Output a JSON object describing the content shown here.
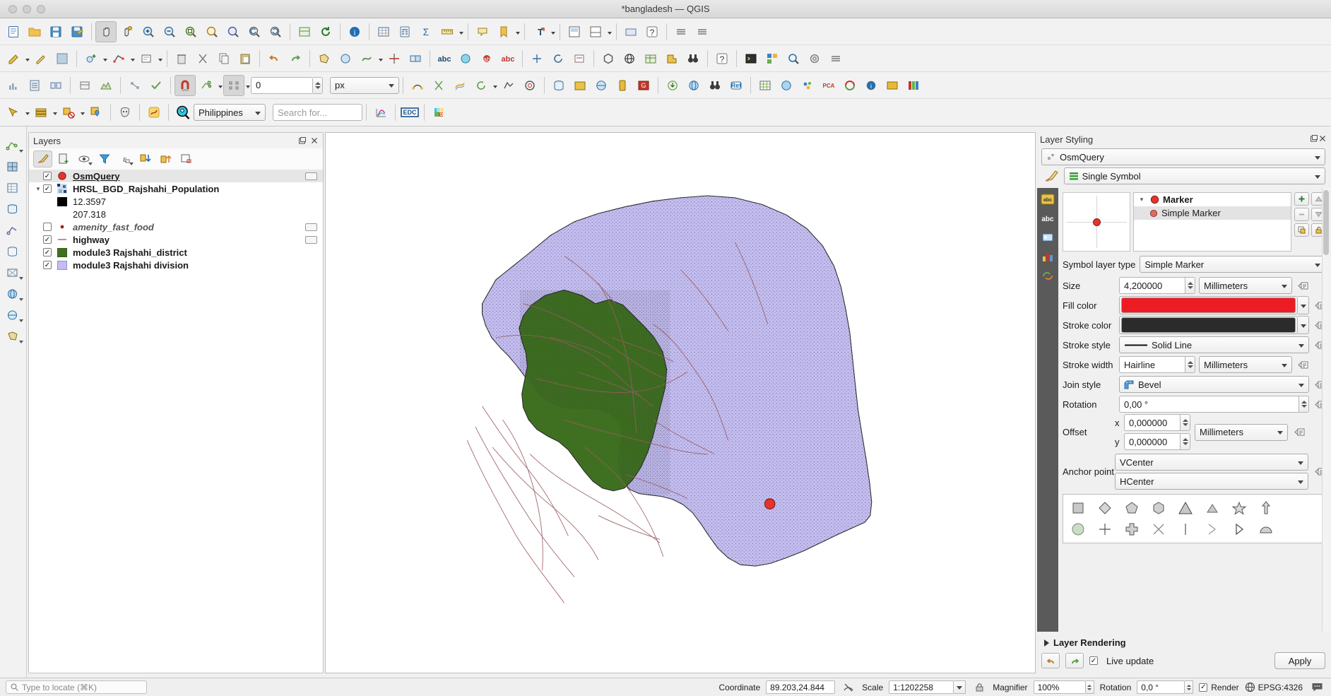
{
  "window": {
    "title": "*bangladesh — QGIS"
  },
  "toolbar": {
    "snapping_units_value": "0",
    "snapping_units": "px",
    "country_selector": "Philippines",
    "search_placeholder": "Search for...",
    "edc_label": "EDC"
  },
  "layers_panel": {
    "title": "Layers",
    "items": [
      {
        "name": "OsmQuery",
        "checked": true,
        "style": "bold-underline",
        "symbol": "red-circle",
        "indent": 0,
        "expander": "",
        "badge": true,
        "selected": true
      },
      {
        "name": "HRSL_BGD_Rajshahi_Population",
        "checked": true,
        "style": "bold",
        "symbol": "raster-swatch",
        "indent": 0,
        "expander": "down",
        "badge": false,
        "selected": false
      },
      {
        "name": "12.3597",
        "checked": null,
        "style": "plain",
        "symbol": "black-swatch",
        "indent": 1,
        "expander": "",
        "badge": false,
        "selected": false
      },
      {
        "name": "207.318",
        "checked": null,
        "style": "plain",
        "symbol": "none",
        "indent": 1,
        "expander": "",
        "badge": false,
        "selected": false
      },
      {
        "name": "amenity_fast_food",
        "checked": false,
        "style": "italic",
        "symbol": "small-red-dot",
        "indent": 0,
        "expander": "",
        "badge": true,
        "selected": false
      },
      {
        "name": "highway",
        "checked": true,
        "style": "bold",
        "symbol": "pink-line",
        "indent": 0,
        "expander": "",
        "badge": true,
        "selected": false
      },
      {
        "name": "module3 Rajshahi_district",
        "checked": true,
        "style": "bold",
        "symbol": "green-swatch",
        "indent": 0,
        "expander": "",
        "badge": false,
        "selected": false
      },
      {
        "name": "module3 Rajshahi division",
        "checked": true,
        "style": "bold",
        "symbol": "lavender-swatch",
        "indent": 0,
        "expander": "",
        "badge": false,
        "selected": false
      }
    ]
  },
  "style_panel": {
    "title": "Layer Styling",
    "layer_name": "OsmQuery",
    "renderer": "Single Symbol",
    "symbol_tree": {
      "root": "Marker",
      "child": "Simple Marker"
    },
    "symbol_layer_type_label": "Symbol layer type",
    "symbol_layer_type": "Simple Marker",
    "fields": {
      "size_label": "Size",
      "size_value": "4,200000",
      "size_unit": "Millimeters",
      "fill_color_label": "Fill color",
      "fill_color": "#ED1C24",
      "stroke_color_label": "Stroke color",
      "stroke_color": "#2B2B2B",
      "stroke_style_label": "Stroke style",
      "stroke_style": "Solid Line",
      "stroke_width_label": "Stroke width",
      "stroke_width": "Hairline",
      "stroke_width_unit": "Millimeters",
      "join_style_label": "Join style",
      "join_style": "Bevel",
      "rotation_label": "Rotation",
      "rotation": "0,00 °",
      "offset_label": "Offset",
      "offset_x_label": "x",
      "offset_x": "0,000000",
      "offset_y_label": "y",
      "offset_y": "0,000000",
      "offset_unit": "Millimeters",
      "anchor_label": "Anchor point",
      "anchor_v": "VCenter",
      "anchor_h": "HCenter"
    },
    "layer_rendering_label": "Layer Rendering",
    "live_update_label": "Live update",
    "live_update_checked": true,
    "apply_label": "Apply"
  },
  "status_bar": {
    "locate_placeholder": "Type to locate (⌘K)",
    "coordinate_label": "Coordinate",
    "coordinate_value": "89.203,24.844",
    "scale_label": "Scale",
    "scale_value": "1:1202258",
    "magnifier_label": "Magnifier",
    "magnifier_value": "100%",
    "rotation_label": "Rotation",
    "rotation_value": "0,0 °",
    "render_label": "Render",
    "render_checked": true,
    "crs_label": "EPSG:4326"
  },
  "map": {
    "division_fill": "#c3bdf0",
    "district_fill": "#3f7021",
    "highway_color": "#9b5b63",
    "marker_color": "#e8332a"
  }
}
